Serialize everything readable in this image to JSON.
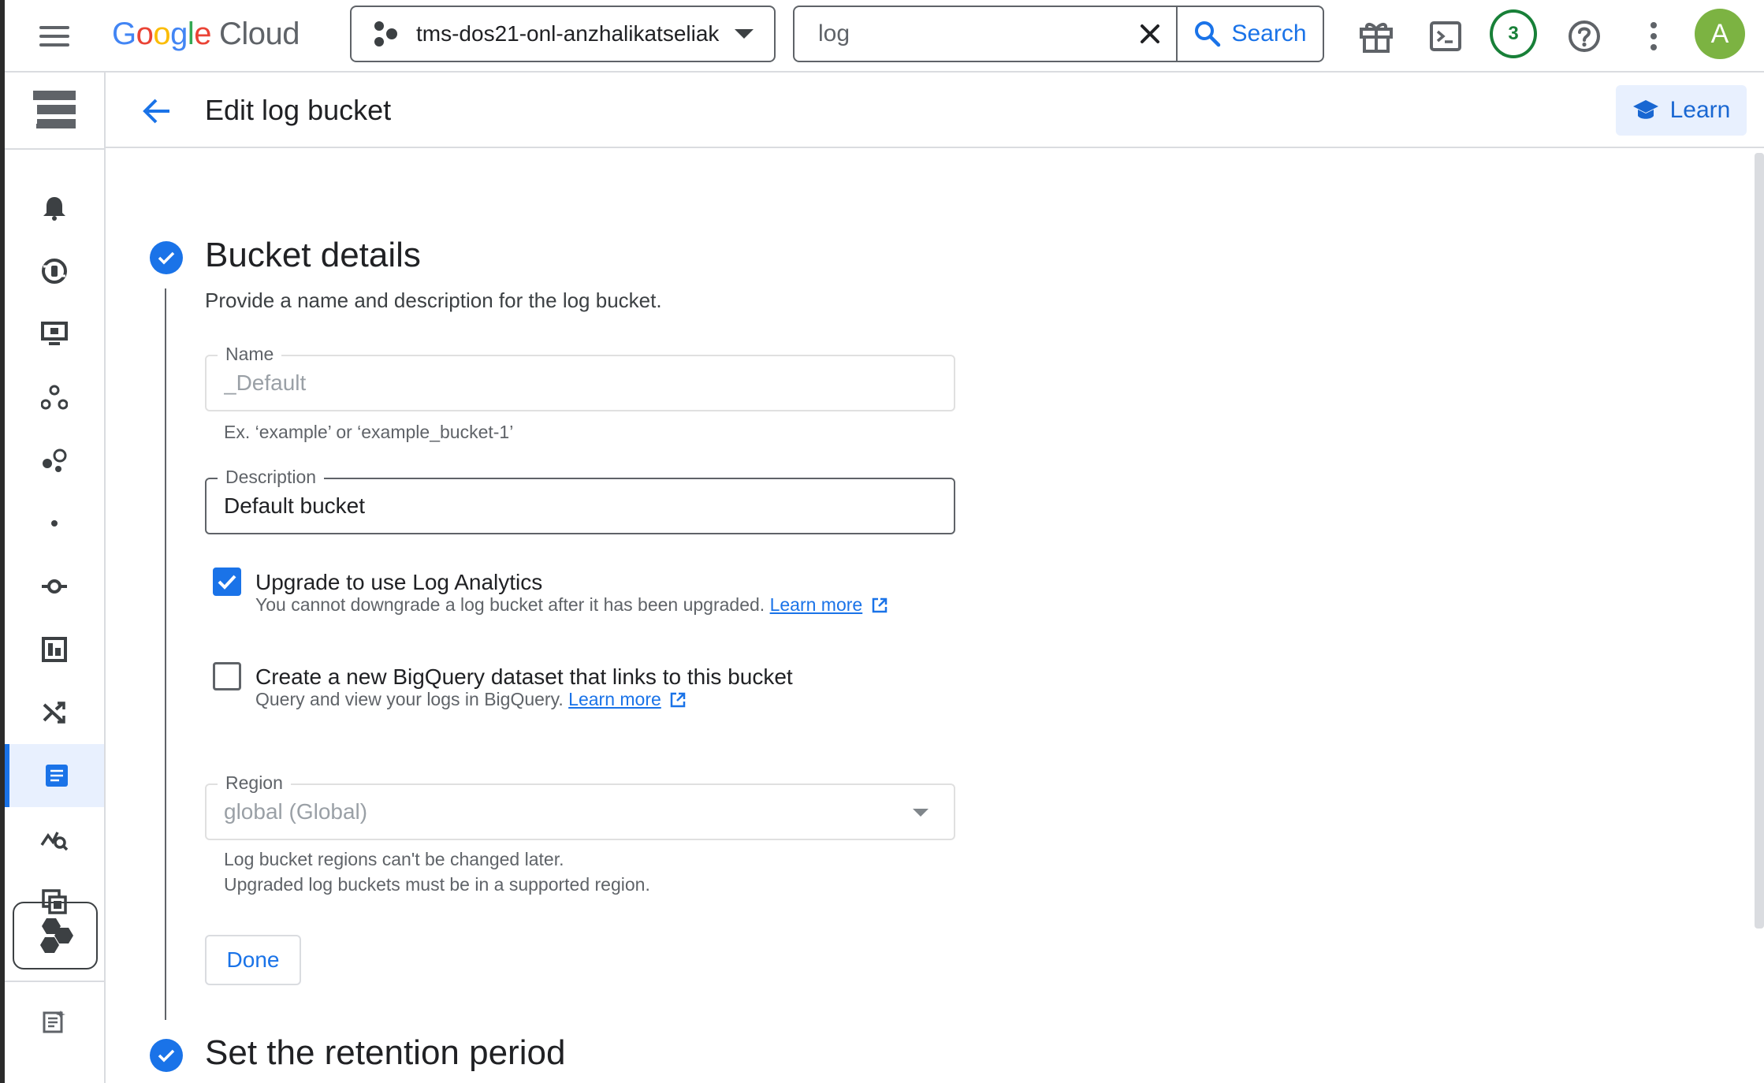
{
  "topbar": {
    "logo": {
      "google": "Google",
      "cloud": "Cloud"
    },
    "project": {
      "name": "tms-dos21-onl-anzhalikatseliak"
    },
    "search": {
      "value": "log",
      "button_label": "Search"
    },
    "notifications_count": "3",
    "avatar_letter": "A"
  },
  "page": {
    "title": "Edit log bucket",
    "learn_label": "Learn"
  },
  "bucket_details": {
    "title": "Bucket details",
    "description": "Provide a name and description for the log bucket.",
    "name_label": "Name",
    "name_value": "_Default",
    "name_helper": "Ex. ‘example’ or ‘example_bucket-1’",
    "description_label": "Description",
    "description_value": "Default bucket",
    "upgrade": {
      "label": "Upgrade to use Log Analytics",
      "sub": "You cannot downgrade a log bucket after it has been upgraded.",
      "link": "Learn more",
      "checked": true
    },
    "bigquery": {
      "label": "Create a new BigQuery dataset that links to this bucket",
      "sub": "Query and view your logs in BigQuery.",
      "link": "Learn more",
      "checked": false
    },
    "region_label": "Region",
    "region_value": "global (Global)",
    "region_helper_1": "Log bucket regions can't be changed later.",
    "region_helper_2": "Upgraded log buckets must be in a supported region.",
    "done_label": "Done"
  },
  "retention": {
    "title": "Set the retention period"
  },
  "colors": {
    "accent": "#1a73e8",
    "success": "#188038",
    "avatar": "#7cb342"
  }
}
